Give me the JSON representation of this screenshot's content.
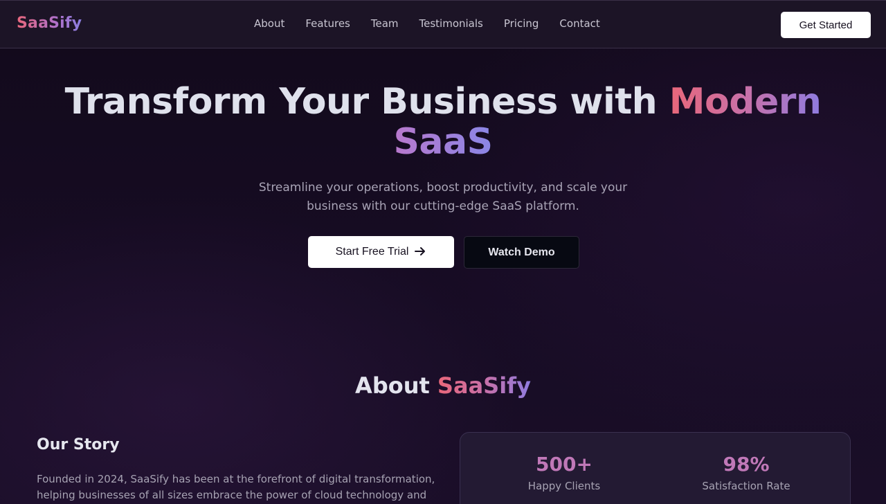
{
  "brand": {
    "logo": "SaaSify"
  },
  "nav": {
    "links": [
      "About",
      "Features",
      "Team",
      "Testimonials",
      "Pricing",
      "Contact"
    ],
    "cta": "Get Started"
  },
  "hero": {
    "title_main": "Transform Your Business with ",
    "title_highlight_1": "Modern",
    "title_highlight_2": "SaaS",
    "subtitle": "Streamline your operations, boost productivity, and scale your business with our cutting-edge SaaS platform.",
    "primary_cta": "Start Free Trial",
    "secondary_cta": "Watch Demo"
  },
  "about": {
    "title_prefix": "About ",
    "title_highlight": "SaaSify",
    "story_title": "Our Story",
    "story_text": "Founded in 2024, SaaSify has been at the forefront of digital transformation, helping businesses of all sizes embrace the power of cloud technology and",
    "stats": [
      {
        "value": "500+",
        "label": "Happy Clients"
      },
      {
        "value": "98%",
        "label": "Satisfaction Rate"
      }
    ]
  },
  "colors": {
    "accent_pink": "#e9677a",
    "accent_purple": "#8f7ce0",
    "background": "#140a1f"
  }
}
